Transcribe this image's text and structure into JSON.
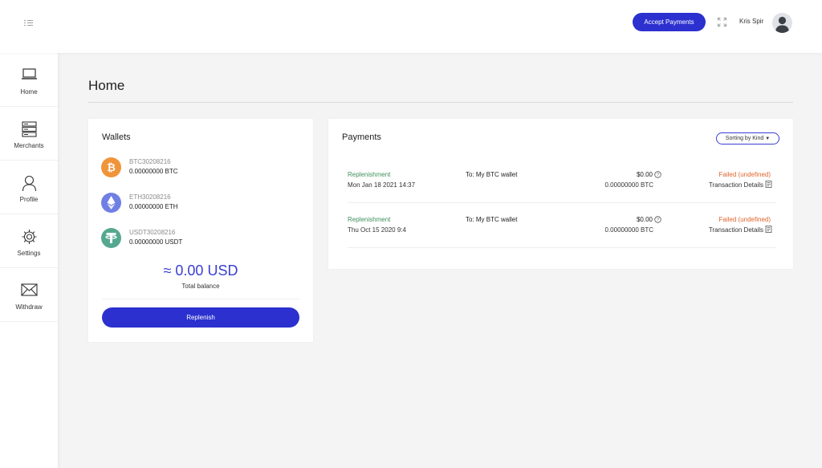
{
  "header": {
    "accept_payments_label": "Accept Payments",
    "user_name": "Kris Spir"
  },
  "sidebar": {
    "items": [
      {
        "label": "Home",
        "icon": "laptop-icon"
      },
      {
        "label": "Merchants",
        "icon": "server-icon"
      },
      {
        "label": "Profile",
        "icon": "user-icon"
      },
      {
        "label": "Settings",
        "icon": "gear-icon"
      },
      {
        "label": "Withdraw",
        "icon": "envelope-icon"
      }
    ]
  },
  "page": {
    "title": "Home"
  },
  "wallets": {
    "title": "Wallets",
    "items": [
      {
        "name": "BTC30208216",
        "amount": "0.00000000 BTC",
        "icon": "bitcoin-icon",
        "color": "#f0943a"
      },
      {
        "name": "ETH30208216",
        "amount": "0.00000000 ETH",
        "icon": "ethereum-icon",
        "color": "#6f7fe4"
      },
      {
        "name": "USDT30208216",
        "amount": "0.00000000 USDT",
        "icon": "tether-icon",
        "color": "#55a88f"
      }
    ],
    "total_value": "≈ 0.00 USD",
    "total_label": "Total balance",
    "replenish_label": "Replenish"
  },
  "payments": {
    "title": "Payments",
    "sort_label": "Sorting by Kind",
    "rows": [
      {
        "kind": "Replenishment",
        "date": "Mon Jan 18 2021 14:37",
        "to": "To: My BTC wallet",
        "usd": "$0.00",
        "crypto": "0.00000000 BTC",
        "status": "Failed (undefined)",
        "details": "Transaction Details"
      },
      {
        "kind": "Replenishment",
        "date": "Thu Oct 15 2020 9:4",
        "to": "To: My BTC wallet",
        "usd": "$0.00",
        "crypto": "0.00000000 BTC",
        "status": "Failed (undefined)",
        "details": "Transaction Details"
      }
    ]
  },
  "colors": {
    "accent": "#2b30cf",
    "success": "#3f8f5c",
    "failed": "#e0642c",
    "total": "#3a3fcf"
  }
}
